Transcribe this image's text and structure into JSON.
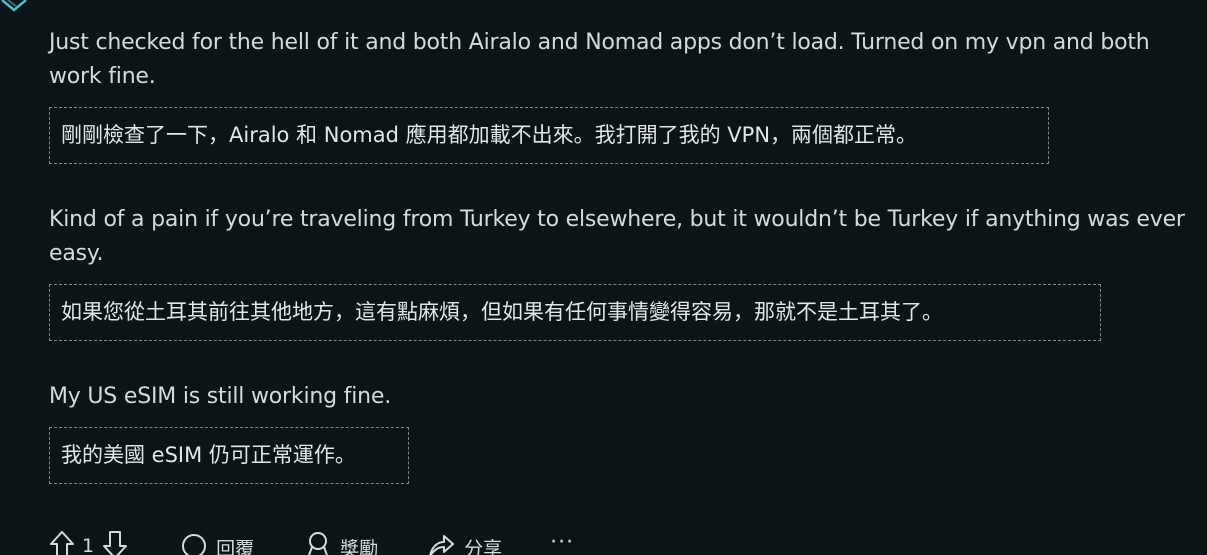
{
  "comment": {
    "paragraphs": [
      {
        "original": "Just checked for the hell of it and both Airalo and Nomad apps don’t load. Turned on my vpn and both work fine.",
        "translation": "剛剛檢查了一下，Airalo 和 Nomad 應用都加載不出來。我打開了我的 VPN，兩個都正常。"
      },
      {
        "original": "Kind of a pain if you’re traveling from Turkey to elsewhere, but it wouldn’t be Turkey if anything was ever easy.",
        "translation": "如果您從土耳其前往其他地方，這有點麻煩，但如果有任何事情變得容易，那就不是土耳其了。"
      },
      {
        "original": "My US eSIM is still working fine.",
        "translation": "我的美國 eSIM 仍可正常運作。"
      }
    ]
  },
  "actions": {
    "vote_count": "1",
    "reply_label": "回覆",
    "award_label": "獎勵",
    "share_label": "分享",
    "more_label": "···",
    "upvote_icon": "upvote-icon",
    "downvote_icon": "downvote-icon",
    "reply_icon": "comment-bubble-icon",
    "award_icon": "award-icon",
    "share_icon": "share-arrow-icon",
    "more_icon": "more-dots-icon"
  },
  "colors": {
    "background": "#0b1416",
    "text": "#d7dadc",
    "dashed_border": "#7c8a8f",
    "corner_accent": "#4fbcd0"
  }
}
